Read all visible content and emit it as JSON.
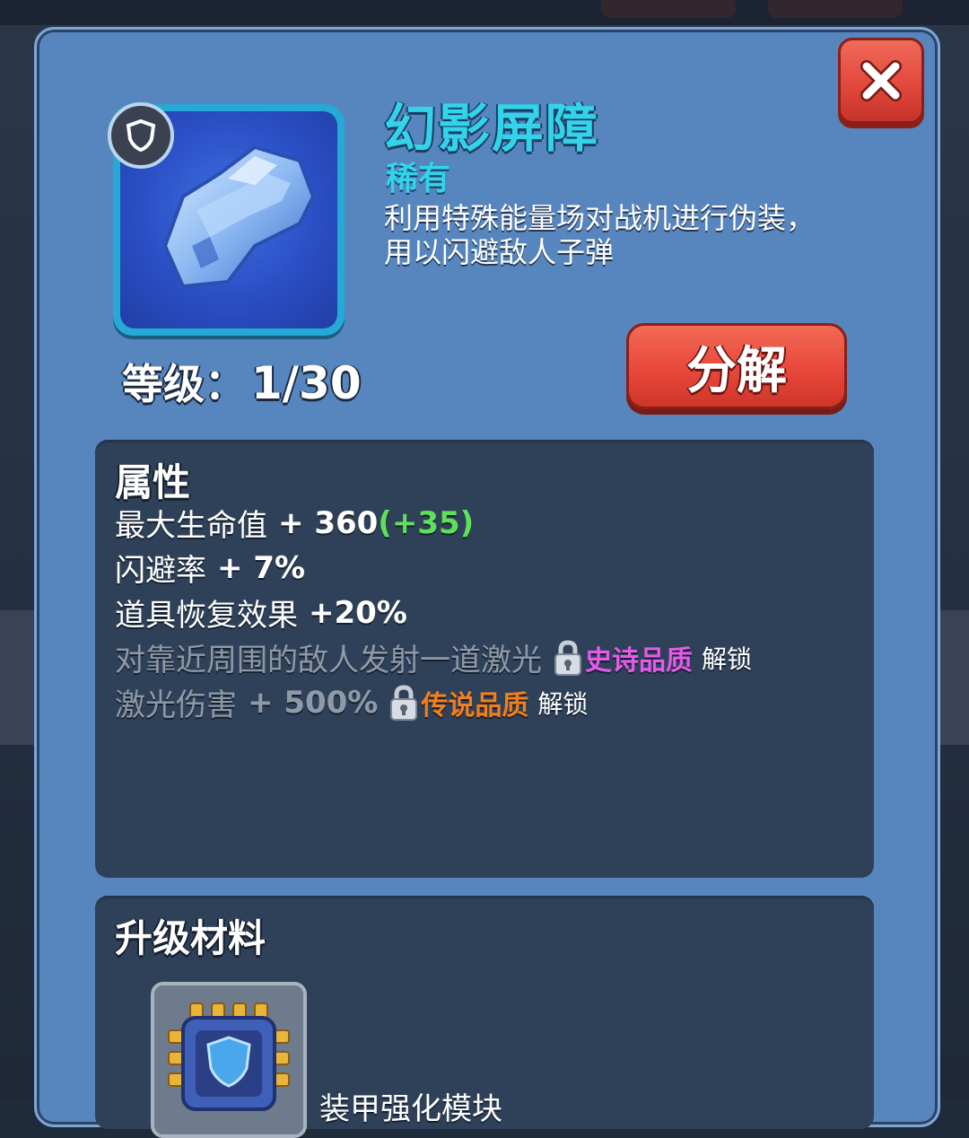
{
  "item": {
    "name": "幻影屏障",
    "rarity": "稀有",
    "description": "利用特殊能量场对战机进行伪装，用以闪避敌人子弹",
    "level_label": "等级：",
    "level_value": "1/30",
    "icon": "phantom-barrier-armor",
    "type_badge_icon": "shield-icon"
  },
  "buttons": {
    "decompose_label": "分解",
    "close_icon": "close-icon"
  },
  "attributes": {
    "title": "属性",
    "lines": [
      {
        "label": "最大生命值",
        "value": "+ 360",
        "bonus": "(+35)"
      },
      {
        "label": "闪避率",
        "value": "+ 7%"
      },
      {
        "label": "道具恢复效果",
        "value": "+20%"
      }
    ],
    "locked_lines": [
      {
        "label": "对靠近周围的敌人发射一道激光",
        "quality": "史诗品质",
        "unlock": "解锁",
        "quality_color": "#e35be8"
      },
      {
        "label": "激光伤害",
        "value": "+ 500%",
        "quality": "传说品质",
        "unlock": "解锁",
        "quality_color": "#f07f1c"
      }
    ]
  },
  "materials": {
    "title": "升级材料",
    "items": [
      {
        "icon": "chip-module-icon",
        "name": "装甲强化模块"
      }
    ]
  },
  "colors": {
    "panel": "#5785bd",
    "accent_cyan": "#33d4ea",
    "button_red": "#e9473b",
    "bonus_green": "#5fe05a"
  }
}
